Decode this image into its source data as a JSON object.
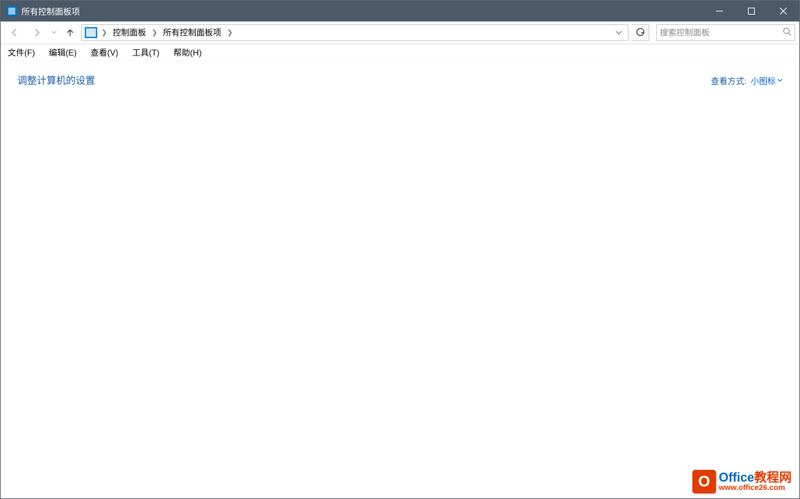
{
  "window": {
    "title": "所有控制面板项"
  },
  "breadcrumb": {
    "root": "控制面板",
    "items": [
      "所有控制面板项"
    ]
  },
  "search": {
    "placeholder": "搜索控制面板"
  },
  "menu": {
    "file": "文件(F)",
    "edit": "编辑(E)",
    "view": "查看(V)",
    "tools": "工具(T)",
    "help": "帮助(H)"
  },
  "content": {
    "title": "调整计算机的设置",
    "viewby_label": "查看方式:",
    "viewby_value": "小图标"
  },
  "watermark": {
    "top_blue": "Office",
    "top_orange": "教程网",
    "bottom": "www.office26.com",
    "icon": "O"
  }
}
